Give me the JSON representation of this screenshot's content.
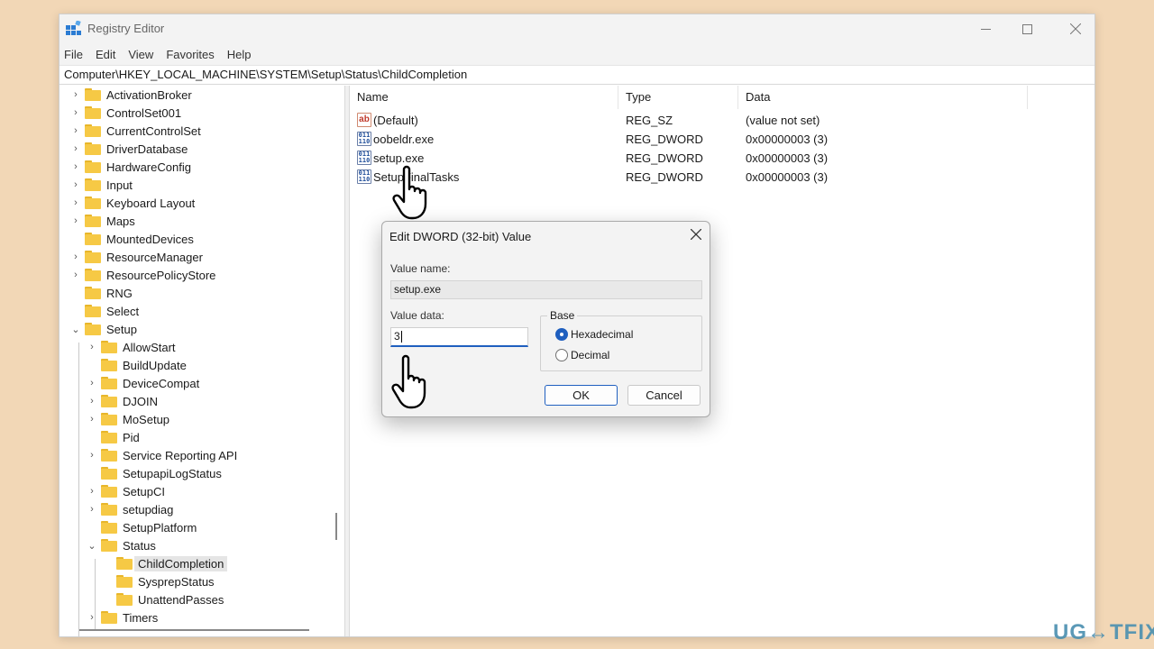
{
  "window": {
    "title": "Registry Editor"
  },
  "menu": [
    "File",
    "Edit",
    "View",
    "Favorites",
    "Help"
  ],
  "address": "Computer\\HKEY_LOCAL_MACHINE\\SYSTEM\\Setup\\Status\\ChildCompletion",
  "tree": [
    {
      "label": "ActivationBroker",
      "chevron": "›"
    },
    {
      "label": "ControlSet001",
      "chevron": "›"
    },
    {
      "label": "CurrentControlSet",
      "chevron": "›"
    },
    {
      "label": "DriverDatabase",
      "chevron": "›"
    },
    {
      "label": "HardwareConfig",
      "chevron": "›"
    },
    {
      "label": "Input",
      "chevron": "›"
    },
    {
      "label": "Keyboard Layout",
      "chevron": "›"
    },
    {
      "label": "Maps",
      "chevron": "›"
    },
    {
      "label": "MountedDevices",
      "chevron": ""
    },
    {
      "label": "ResourceManager",
      "chevron": "›"
    },
    {
      "label": "ResourcePolicyStore",
      "chevron": "›"
    },
    {
      "label": "RNG",
      "chevron": ""
    },
    {
      "label": "Select",
      "chevron": ""
    },
    {
      "label": "Setup",
      "chevron": "⌄"
    },
    {
      "label": "AllowStart",
      "chevron": "›"
    },
    {
      "label": "BuildUpdate",
      "chevron": ""
    },
    {
      "label": "DeviceCompat",
      "chevron": "›"
    },
    {
      "label": "DJOIN",
      "chevron": "›"
    },
    {
      "label": "MoSetup",
      "chevron": "›"
    },
    {
      "label": "Pid",
      "chevron": ""
    },
    {
      "label": "Service Reporting API",
      "chevron": "›"
    },
    {
      "label": "SetupapiLogStatus",
      "chevron": ""
    },
    {
      "label": "SetupCI",
      "chevron": "›"
    },
    {
      "label": "setupdiag",
      "chevron": "›"
    },
    {
      "label": "SetupPlatform",
      "chevron": ""
    },
    {
      "label": "Status",
      "chevron": "⌄"
    },
    {
      "label": "ChildCompletion",
      "chevron": ""
    },
    {
      "label": "SysprepStatus",
      "chevron": ""
    },
    {
      "label": "UnattendPasses",
      "chevron": ""
    },
    {
      "label": "Timers",
      "chevron": "›"
    }
  ],
  "columns": {
    "name": "Name",
    "type": "Type",
    "data": "Data"
  },
  "values": [
    {
      "name": "(Default)",
      "type": "REG_SZ",
      "data": "(value not set)",
      "icon": "string-value-icon"
    },
    {
      "name": "oobeldr.exe",
      "type": "REG_DWORD",
      "data": "0x00000003 (3)",
      "icon": "binary-value-icon"
    },
    {
      "name": "setup.exe",
      "type": "REG_DWORD",
      "data": "0x00000003 (3)",
      "icon": "binary-value-icon"
    },
    {
      "name": "SetupFinalTasks",
      "type": "REG_DWORD",
      "data": "0x00000003 (3)",
      "icon": "binary-value-icon"
    }
  ],
  "dialog": {
    "title": "Edit DWORD (32-bit) Value",
    "value_name_label": "Value name:",
    "value_name": "setup.exe",
    "value_data_label": "Value data:",
    "value_data": "3",
    "base_label": "Base",
    "hex_label": "Hexadecimal",
    "dec_label": "Decimal",
    "selected_base": "Hexadecimal",
    "ok_label": "OK",
    "cancel_label": "Cancel"
  },
  "watermark": "UG↔TFIX"
}
